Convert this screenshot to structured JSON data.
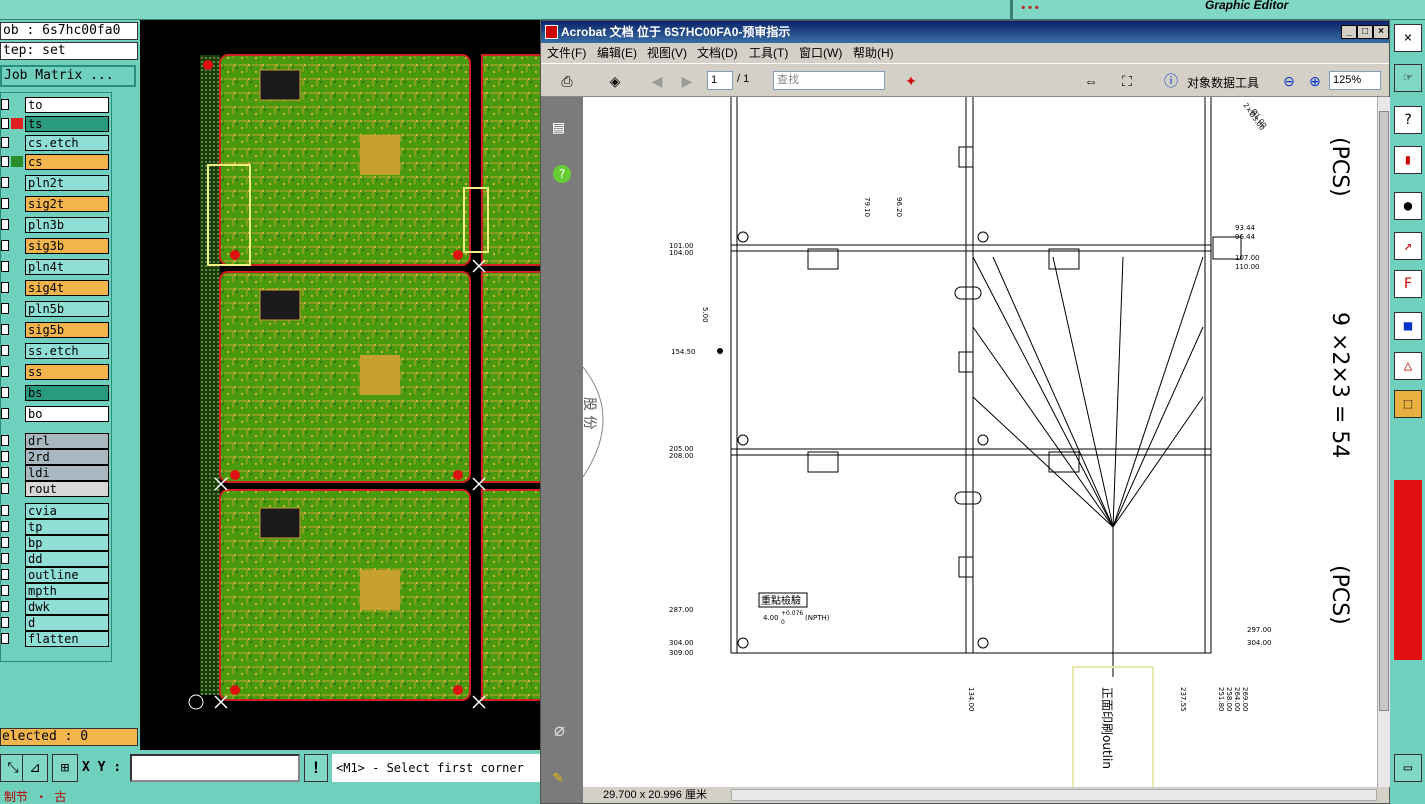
{
  "top": {
    "brand": "…",
    "graphic_editor": "Graphic Editor"
  },
  "left": {
    "job": "ob : 6s7hc00fa0",
    "step": "tep: set",
    "job_matrix": "Job Matrix ...",
    "layers": [
      {
        "name": "to",
        "bg": "#ffffff",
        "swatch": ""
      },
      {
        "name": "ts",
        "bg": "#2a9a7e",
        "swatch": "#e02020"
      },
      {
        "name": "cs.etch",
        "bg": "#8fdfd6",
        "swatch": ""
      },
      {
        "name": "cs",
        "bg": "#f2b44c",
        "swatch": "#2a8c2a"
      },
      {
        "name": "pln2t",
        "bg": "#8fdfd6",
        "swatch": ""
      },
      {
        "name": "sig2t",
        "bg": "#f2b44c",
        "swatch": ""
      },
      {
        "name": "pln3b",
        "bg": "#8fdfd6",
        "swatch": ""
      },
      {
        "name": "sig3b",
        "bg": "#f2b44c",
        "swatch": ""
      },
      {
        "name": "pln4t",
        "bg": "#8fdfd6",
        "swatch": ""
      },
      {
        "name": "sig4t",
        "bg": "#f2b44c",
        "swatch": ""
      },
      {
        "name": "pln5b",
        "bg": "#8fdfd6",
        "swatch": ""
      },
      {
        "name": "sig5b",
        "bg": "#f2b44c",
        "swatch": ""
      },
      {
        "name": "ss.etch",
        "bg": "#8fdfd6",
        "swatch": ""
      },
      {
        "name": "ss",
        "bg": "#f2b44c",
        "swatch": ""
      },
      {
        "name": "bs",
        "bg": "#2a9a7e",
        "swatch": ""
      },
      {
        "name": "bo",
        "bg": "#ffffff",
        "swatch": ""
      },
      {
        "name": "drl",
        "bg": "#a9b8c0",
        "swatch": ""
      },
      {
        "name": "2rd",
        "bg": "#a9b8c0",
        "swatch": ""
      },
      {
        "name": "ldi",
        "bg": "#a9b8c0",
        "swatch": ""
      },
      {
        "name": "rout",
        "bg": "#d8d8d8",
        "swatch": ""
      },
      {
        "name": "cvia",
        "bg": "#8fdfd6",
        "swatch": ""
      },
      {
        "name": "tp",
        "bg": "#8fdfd6",
        "swatch": ""
      },
      {
        "name": "bp",
        "bg": "#8fdfd6",
        "swatch": ""
      },
      {
        "name": "dd",
        "bg": "#8fdfd6",
        "swatch": ""
      },
      {
        "name": "outline",
        "bg": "#8fdfd6",
        "swatch": ""
      },
      {
        "name": "mpth",
        "bg": "#8fdfd6",
        "swatch": ""
      },
      {
        "name": "dwk",
        "bg": "#8fdfd6",
        "swatch": ""
      },
      {
        "name": "d",
        "bg": "#8fdfd6",
        "swatch": ""
      },
      {
        "name": "flatten",
        "bg": "#8fdfd6",
        "swatch": ""
      }
    ],
    "selected": "elected : 0"
  },
  "bottom": {
    "xy_label": "X Y :",
    "xy_value": "",
    "status": "<M1> - Select first corner",
    "taskbar": "制节 ・ 古"
  },
  "acrobat": {
    "title": "Acrobat 文档 位于 6S7HC00FA0-预审指示",
    "menu": [
      "文件(F)",
      "编辑(E)",
      "视图(V)",
      "文档(D)",
      "工具(T)",
      "窗口(W)",
      "帮助(H)"
    ],
    "page": "1",
    "page_total": "/ 1",
    "find_placeholder": "查找",
    "object_tool": "对象数据工具",
    "zoom": "125%",
    "status_size": "29.700 x 20.996 厘米"
  },
  "drawing": {
    "dims_left_top": [
      "101.00",
      "104.00"
    ],
    "dims_right_top": [
      "93.44",
      "96.44",
      "107.00",
      "110.00"
    ],
    "dims_left_mid": [
      "205.00",
      "208.00"
    ],
    "dims_left_bot": [
      "287.00",
      "304.00",
      "309.00"
    ],
    "dims_right_bot": [
      "297.00",
      "304.00"
    ],
    "dim_154": "154.50",
    "dim_5": "5.00",
    "dim_79": "79.10",
    "dim_96": "96.20",
    "dim_134": "134.00",
    "dim_237": "237.55",
    "dims_bottom_right": [
      "251.80",
      "258.00",
      "264.00",
      "269.00"
    ],
    "hole_note": "4.00",
    "hole_tol": "+0.076",
    "hole_tol_low": "0",
    "npth": "(NPTH)",
    "key_check": "重點檢驗",
    "front_print": "正面印刷outlin",
    "side_text_1": "(PCS)",
    "side_text_2": "9 ×2×3 = 54",
    "side_text_3": "(PCS)",
    "stamp": "股 份",
    "corner_note_1": "2×Ø3.00",
    "corner_note_2": "Ø1.00"
  }
}
